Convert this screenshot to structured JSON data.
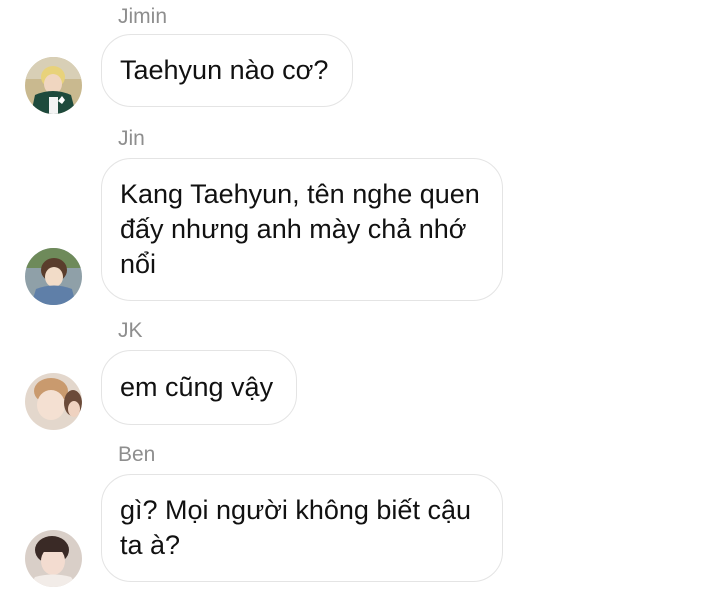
{
  "messages": [
    {
      "sender": "Jimin",
      "text": "Taehyun nào cơ?",
      "avatar": "jimin-avatar"
    },
    {
      "sender": "Jin",
      "text": "Kang Taehyun, tên nghe quen đấy nhưng anh mày chả nhớ nổi",
      "avatar": "jin-avatar"
    },
    {
      "sender": "JK",
      "text": "em cũng vậy",
      "avatar": "jk-avatar"
    },
    {
      "sender": "Ben",
      "text": "gì? Mọi người không biết cậu ta à?",
      "avatar": "ben-avatar"
    }
  ]
}
